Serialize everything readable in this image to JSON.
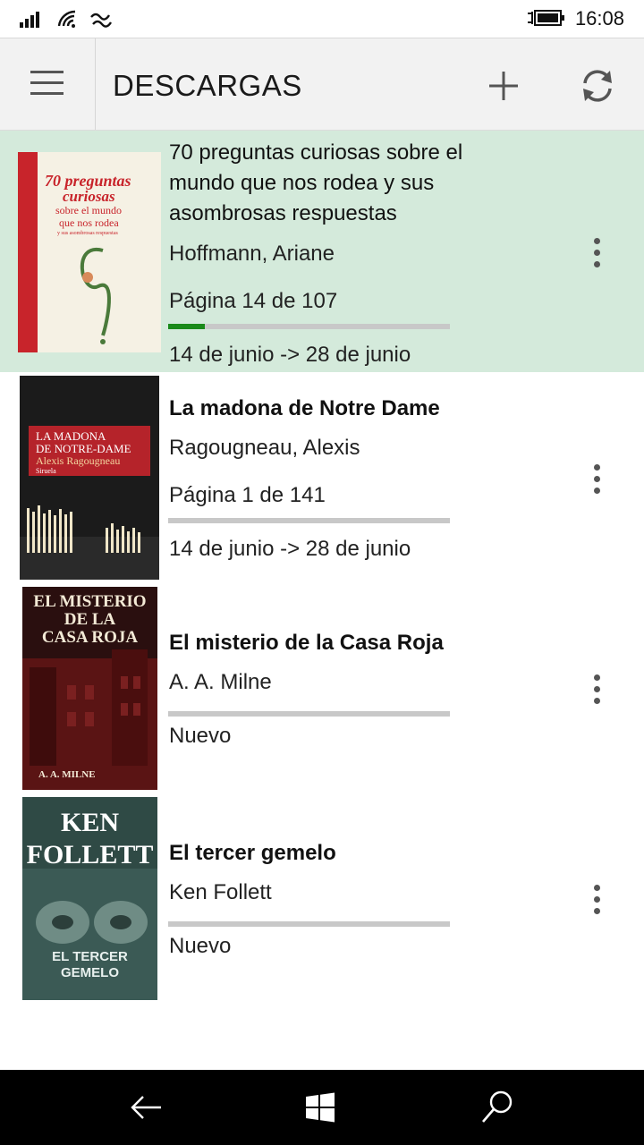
{
  "status_bar": {
    "time": "16:08"
  },
  "header": {
    "title": "DESCARGAS"
  },
  "books": [
    {
      "title": "70 preguntas curiosas sobre el mundo que nos rodea y sus asombrosas respuestas",
      "author": "Hoffmann, Ariane",
      "page_text": "Página 14 de 107",
      "progress": 0.13,
      "dates": "14 de junio -> 28 de junio",
      "cover": {
        "line1": "70 preguntas",
        "line2": "curiosas",
        "line3": "sobre el mundo",
        "line4": "que nos rodea",
        "sub": "y sus asombrosas respuestas"
      }
    },
    {
      "title": "La madona de Notre Dame",
      "author": "Ragougneau, Alexis",
      "page_text": "Página 1 de 141",
      "progress": 0.0,
      "dates": "14 de junio -> 28 de junio",
      "cover": {
        "line1": "LA MADONA",
        "line2": "DE NOTRE-DAME",
        "line3": "Alexis Ragougneau",
        "publisher": "Siruela"
      }
    },
    {
      "title": "El misterio de la Casa Roja",
      "author": "A. A. Milne",
      "progress": 0.0,
      "status": "Nuevo",
      "cover": {
        "line1": "EL MISTERIO",
        "line2": "DE LA",
        "line3": "CASA ROJA",
        "author": "A. A. MILNE"
      }
    },
    {
      "title": "El tercer gemelo",
      "author": "Ken Follett",
      "progress": 0.0,
      "status": "Nuevo",
      "cover": {
        "line1": "KEN",
        "line2": "FOLLETT",
        "line3": "EL TERCER",
        "line4": "GEMELO"
      }
    }
  ],
  "colors": {
    "selected_row": "#d4eadb",
    "progress_fill": "#1a8a1a",
    "progress_track": "#c8c8c8"
  }
}
